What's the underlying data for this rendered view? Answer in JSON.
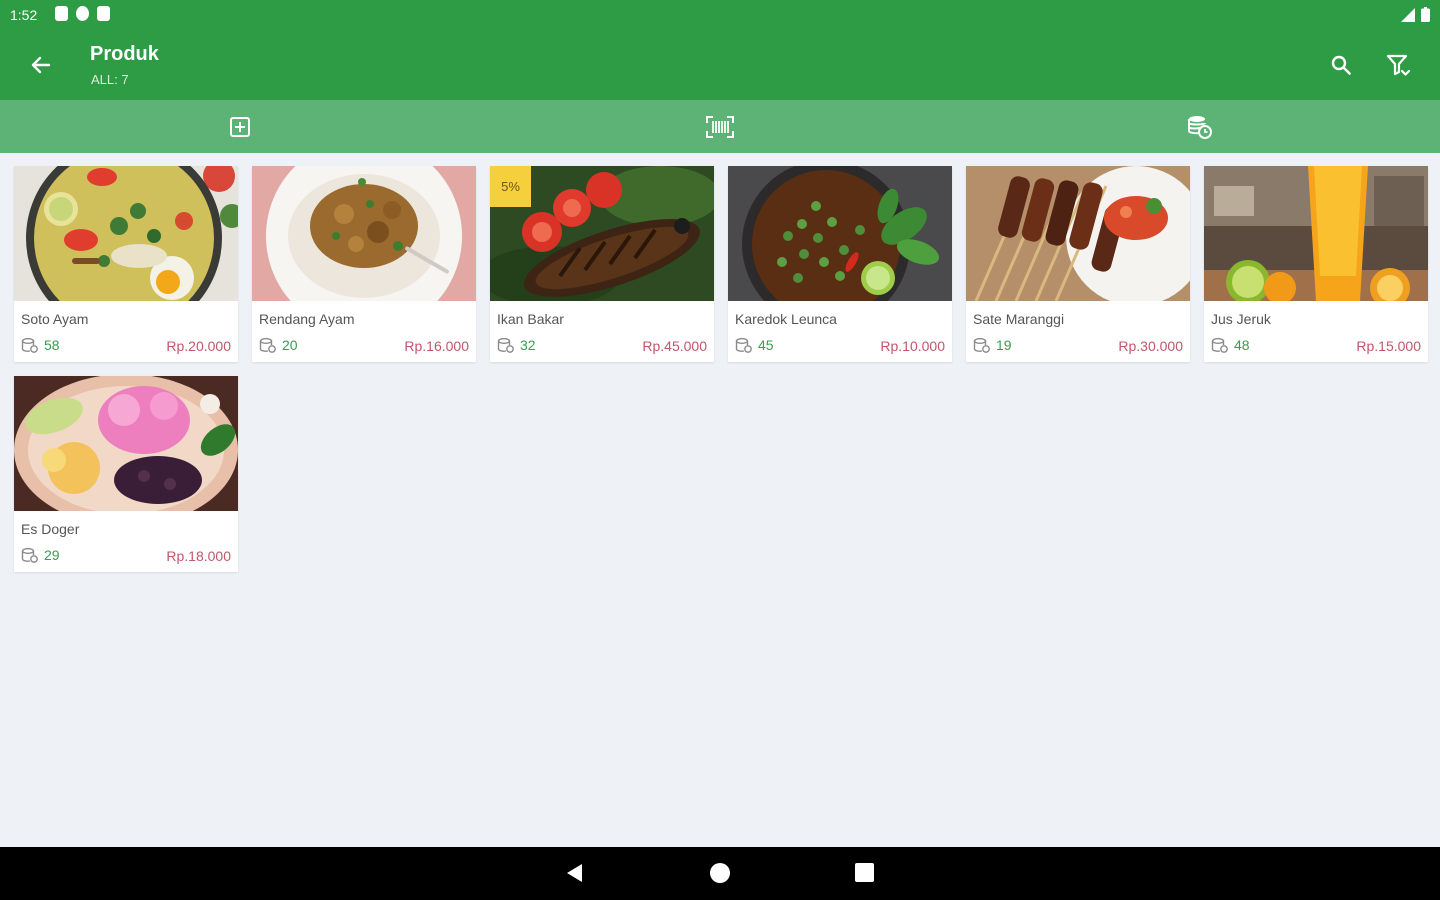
{
  "status": {
    "time": "1:52"
  },
  "header": {
    "title": "Produk",
    "subtitle": "ALL: 7"
  },
  "tabs": [
    {
      "icon": "add-box-icon"
    },
    {
      "icon": "barcode-scan-icon"
    },
    {
      "icon": "stock-history-icon"
    }
  ],
  "products": [
    {
      "name": "Soto Ayam",
      "stock": "58",
      "price": "Rp.20.000"
    },
    {
      "name": "Rendang Ayam",
      "stock": "20",
      "price": "Rp.16.000"
    },
    {
      "name": "Ikan Bakar",
      "stock": "32",
      "price": "Rp.45.000",
      "badge": "5%"
    },
    {
      "name": "Karedok Leunca",
      "stock": "45",
      "price": "Rp.10.000"
    },
    {
      "name": "Sate Maranggi",
      "stock": "19",
      "price": "Rp.30.000"
    },
    {
      "name": "Jus Jeruk",
      "stock": "48",
      "price": "Rp.15.000"
    },
    {
      "name": "Es Doger",
      "stock": "29",
      "price": "Rp.18.000"
    }
  ],
  "colors": {
    "primary": "#2e9c45",
    "tabbar": "#5db276",
    "stock": "#3a9c52",
    "price": "#c0576c",
    "badge": "#f6cf3c"
  }
}
